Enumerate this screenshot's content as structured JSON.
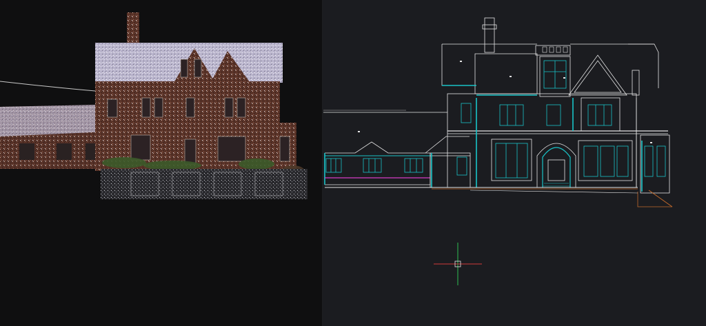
{
  "app": {
    "title": "",
    "left_pane": {
      "name": "point-cloud-scan",
      "background": "#0f0f10"
    },
    "right_pane": {
      "name": "cad-elevation-drawing",
      "background": "#1b1c20"
    }
  },
  "colors": {
    "cad_line": "#e6e6e6",
    "cad_cyan": "#19c4c8",
    "cad_magenta": "#d73cc7",
    "cad_orange": "#c46a2a",
    "crosshair_green": "#2fbf52",
    "crosshair_red": "#d23a3a",
    "brick": "#6b3a2c",
    "roof": "#c9c4d8"
  },
  "icons": {
    "ucs_crosshair": "crosshair-icon"
  }
}
